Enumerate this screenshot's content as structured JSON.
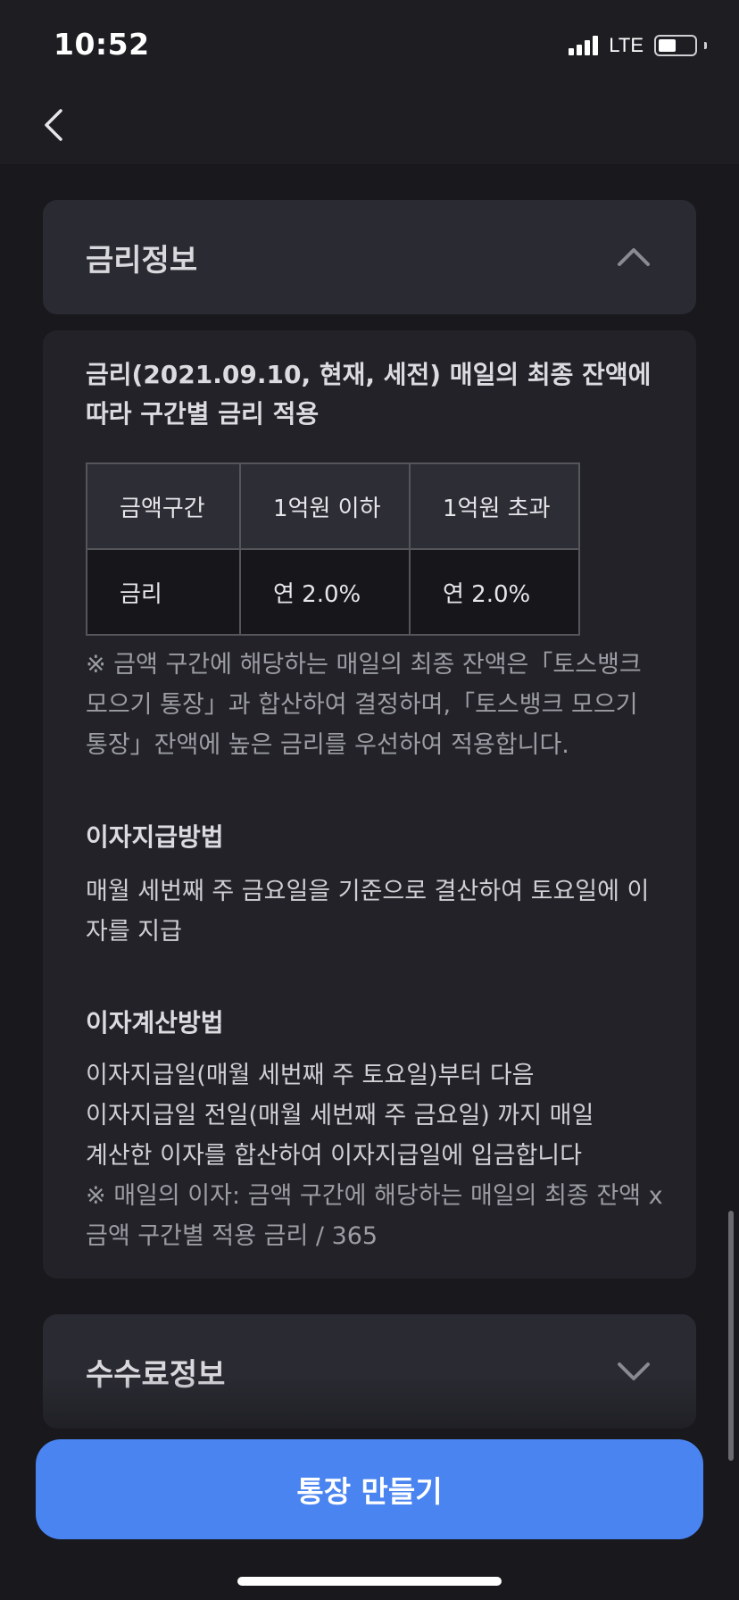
{
  "status_bar": {
    "time": "10:52",
    "network": "LTE",
    "battery_level": 0.5
  },
  "nav": {
    "back_icon": "chevron-left-icon"
  },
  "rate_section": {
    "title": "금리정보",
    "toggle_icon": "chevron-up-icon",
    "intro": "금리(2021.09.10, 현재, 세전) 매일의 최종 잔액에 따라 구간별 금리 적용",
    "table": {
      "headers": [
        "금액구간",
        "1억원 이하",
        "1억원 초과"
      ],
      "rows": [
        [
          "금리",
          "연 2.0%",
          "연 2.0%"
        ]
      ]
    },
    "note": "※ 금액 구간에 해당하는 매일의 최종 잔액은「토스뱅크 모으기 통장」과 합산하여 결정하며,「토스뱅크 모으기 통장」잔액에 높은 금리를 우선하여 적용합니다.",
    "payment": {
      "title": "이자지급방법",
      "text": "매월 세번째 주 금요일을 기준으로 결산하여 토요일에 이자를 지급"
    },
    "calculation": {
      "title": "이자계산방법",
      "line1": "이자지급일(매월 세번째 주 토요일)부터 다음",
      "line2": "이자지급일 전일(매월 세번째 주 금요일) 까지 매일",
      "line3": "계산한 이자를 합산하여 이자지급일에 입금합니다",
      "note": "※ 매일의 이자: 금액 구간에 해당하는 매일의 최종 잔액 x 금액 구간별 적용 금리 / 365"
    }
  },
  "fee_section": {
    "title": "수수료정보",
    "toggle_icon": "chevron-down-icon"
  },
  "cta": {
    "label": "통장 만들기"
  },
  "colors": {
    "background": "#18181d",
    "card": "#2a2a32",
    "panel": "#222228",
    "accent": "#4a84f0"
  }
}
